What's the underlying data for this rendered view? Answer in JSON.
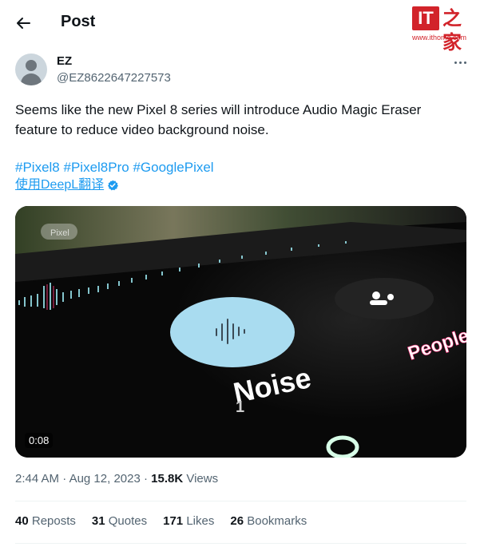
{
  "header": {
    "title": "Post"
  },
  "logo": {
    "mark": "IT",
    "glyph": "之家",
    "url": "www.ithome.com"
  },
  "author": {
    "name": "EZ",
    "handle": "@EZ8622647227573"
  },
  "tweet": {
    "text": "Seems like the new Pixel 8 series will introduce Audio Magic Eraser feature to reduce video background noise.",
    "hashtags": [
      "#Pixel8",
      "#Pixel8Pro",
      "#GooglePixel"
    ],
    "translate_label": "使用DeepL翻译"
  },
  "media": {
    "duration": "0:08",
    "overlay_word": "Noise",
    "overlay_number": "1",
    "overlay_word2": "People",
    "badge_label": "Pixel"
  },
  "meta": {
    "time": "2:44 AM",
    "separator": "·",
    "date": "Aug 12, 2023",
    "views_count": "15.8K",
    "views_label": "Views"
  },
  "stats": [
    {
      "count": "40",
      "label": "Reposts"
    },
    {
      "count": "31",
      "label": "Quotes"
    },
    {
      "count": "171",
      "label": "Likes"
    },
    {
      "count": "26",
      "label": "Bookmarks"
    }
  ],
  "colors": {
    "link": "#1d9bf0",
    "muted": "#536471",
    "logo_red": "#d2232a",
    "noise_button": "#a9dcf0"
  },
  "icons": [
    "back-arrow-icon",
    "more-icon",
    "verified-icon",
    "waveform-icon",
    "avatar-placeholder"
  ]
}
